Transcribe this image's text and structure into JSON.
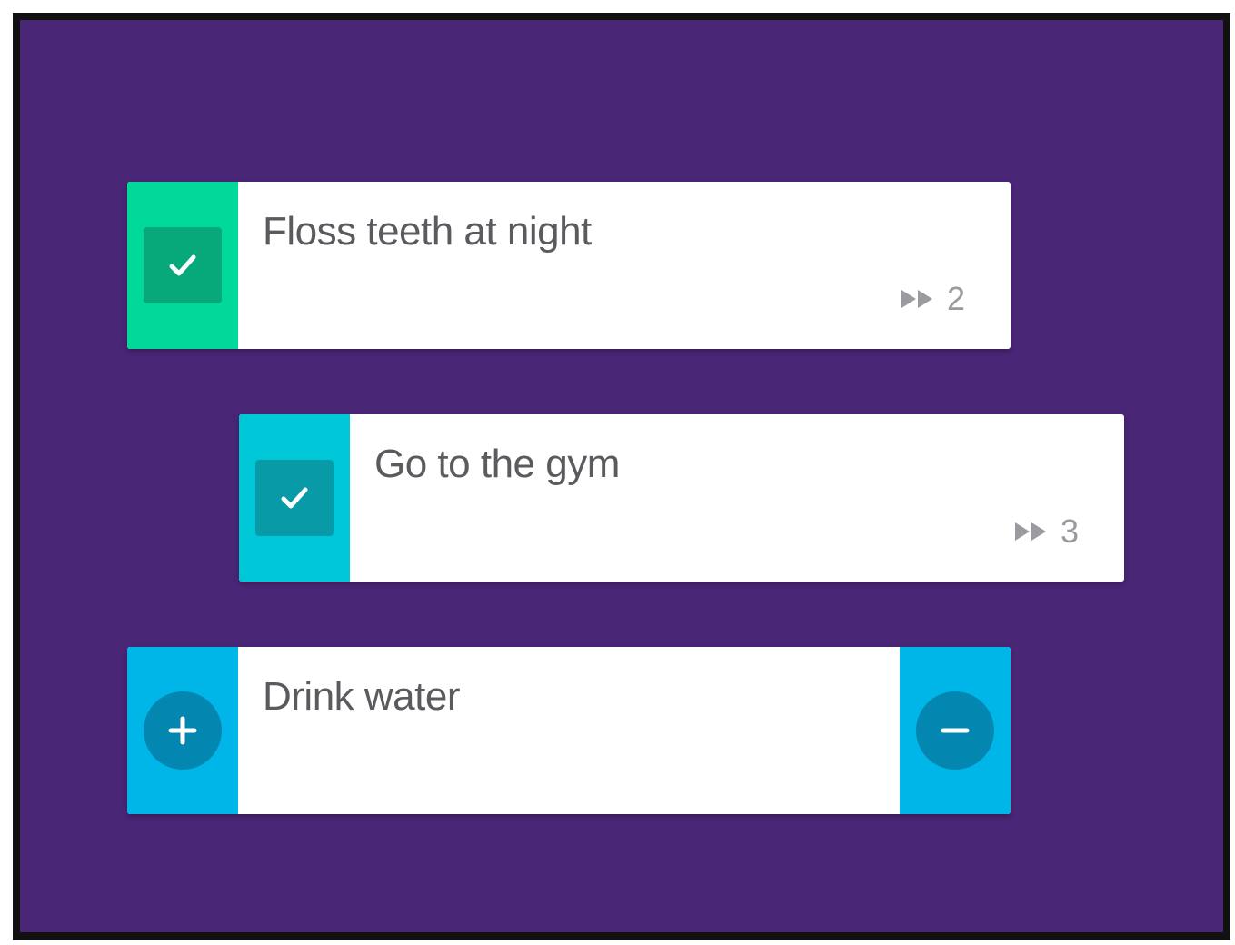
{
  "colors": {
    "background": "#4a2676",
    "frame_border": "#111111",
    "card_background": "#ffffff",
    "title_text": "#5a5a5f",
    "streak_text": "#9a9aa0"
  },
  "habits": [
    {
      "title": "Floss teeth at night",
      "state": "checked",
      "streak": "2",
      "streak_icon": "fast-forward-icon",
      "side_color": "#00d99a",
      "button_color": "#07a87a",
      "button_icon": "checkmark-icon"
    },
    {
      "title": "Go to the gym",
      "state": "checked",
      "streak": "3",
      "streak_icon": "fast-forward-icon",
      "side_color": "#00c7d8",
      "button_color": "#089ba7",
      "button_icon": "checkmark-icon"
    },
    {
      "title": "Drink water",
      "state": "counter",
      "side_color": "#00b6e8",
      "button_color": "#0387b0",
      "increment_icon": "plus-icon",
      "decrement_icon": "minus-icon"
    }
  ]
}
